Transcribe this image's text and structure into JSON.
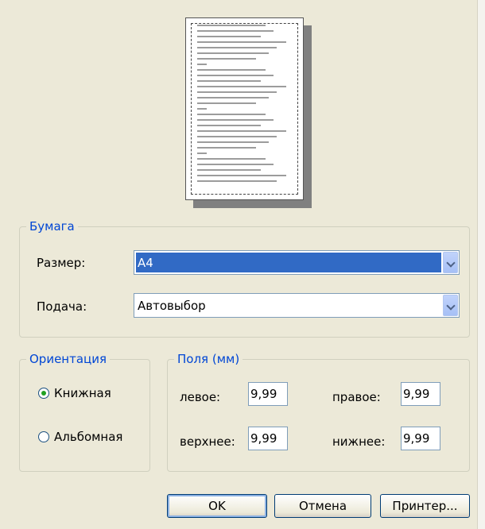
{
  "paper_group": {
    "title": "Бумага",
    "size_label": "Размер:",
    "size_value": "A4",
    "source_label": "Подача:",
    "source_value": "Автовыбор"
  },
  "orientation_group": {
    "title": "Ориентация",
    "portrait_label": "Книжная",
    "landscape_label": "Альбомная",
    "selected": "portrait"
  },
  "margins_group": {
    "title": "Поля (мм)",
    "left_label": "левое:",
    "left_value": "9,99",
    "right_label": "правое:",
    "right_value": "9,99",
    "top_label": "верхнее:",
    "top_value": "9,99",
    "bottom_label": "нижнее:",
    "bottom_value": "9,99"
  },
  "buttons": {
    "ok": "OK",
    "cancel": "Отмена",
    "printer": "Принтер..."
  }
}
